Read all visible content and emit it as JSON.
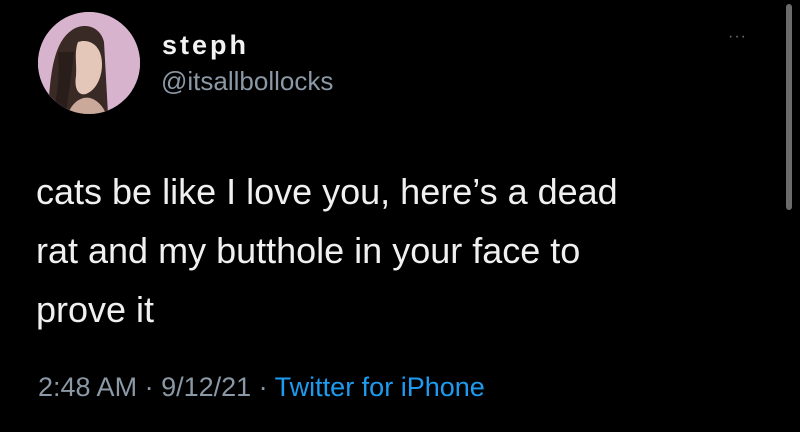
{
  "tweet": {
    "author": {
      "name": "steph",
      "handle": "@itsallbollocks"
    },
    "more_menu": "···",
    "text": "cats be like I love you, here’s a dead\nrat and my butthole in your face to\nprove it",
    "time": "2:48 AM",
    "separator": " · ",
    "date": "9/12/21",
    "source": "Twitter for iPhone"
  },
  "colors": {
    "background": "#000000",
    "text": "#f0f0f0",
    "secondary_text": "#8b98a5",
    "link": "#1d9bf0"
  }
}
